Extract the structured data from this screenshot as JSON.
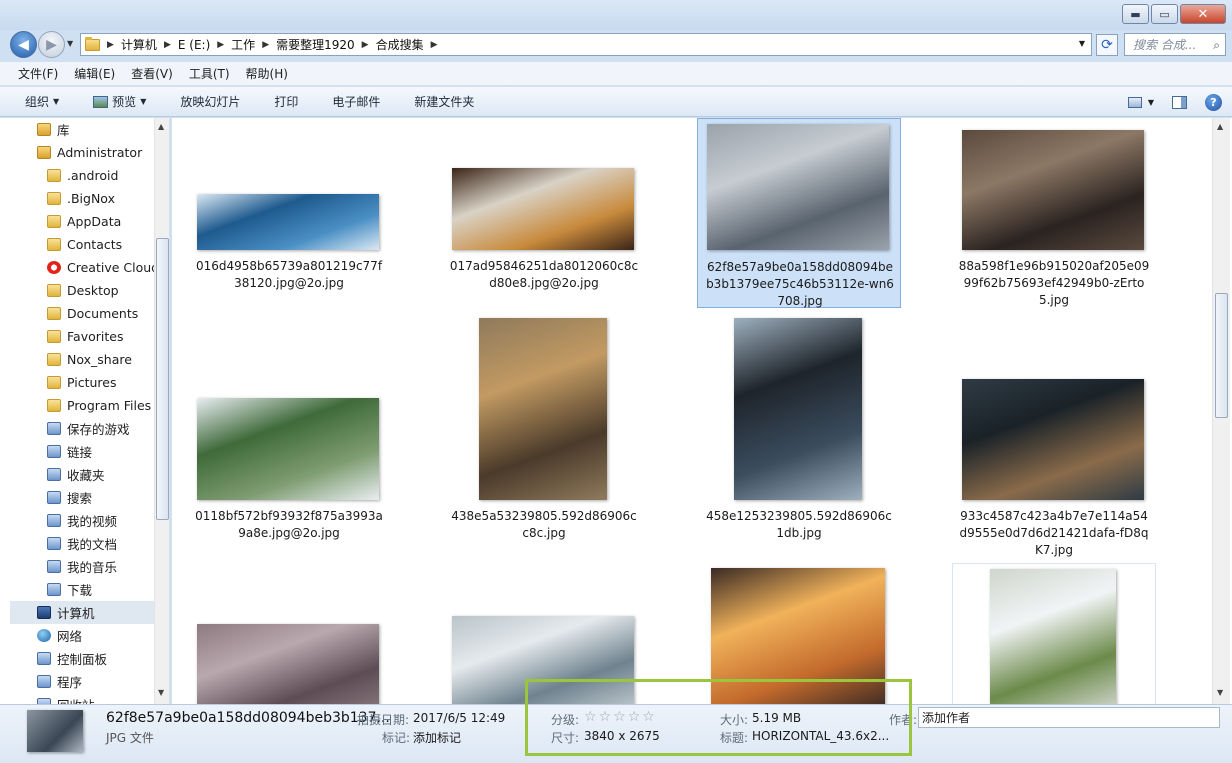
{
  "window": {
    "buttons": {
      "minimize": "▬",
      "maximize": "▭",
      "close": "✕"
    }
  },
  "address": {
    "crumbs": [
      "计算机",
      "E (E:)",
      "工作",
      "需要整理1920",
      "合成搜集"
    ],
    "search_placeholder": "搜索 合成..."
  },
  "menu": [
    "文件(F)",
    "编辑(E)",
    "查看(V)",
    "工具(T)",
    "帮助(H)"
  ],
  "toolbar": {
    "organize": "组织",
    "preview": "预览",
    "slideshow": "放映幻灯片",
    "print": "打印",
    "email": "电子邮件",
    "new_folder": "新建文件夹",
    "help": "?"
  },
  "nav": [
    {
      "label": "库",
      "icon": "library-icon",
      "indent": 1
    },
    {
      "label": "Administrator",
      "icon": "user-folder-icon",
      "indent": 1
    },
    {
      "label": ".android",
      "icon": "folder-icon",
      "indent": 2
    },
    {
      "label": ".BigNox",
      "icon": "folder-icon",
      "indent": 2
    },
    {
      "label": "AppData",
      "icon": "folder-icon",
      "indent": 2
    },
    {
      "label": "Contacts",
      "icon": "folder-icon",
      "indent": 2
    },
    {
      "label": "Creative Cloud",
      "icon": "creative-cloud-icon",
      "indent": 2
    },
    {
      "label": "Desktop",
      "icon": "folder-icon",
      "indent": 2
    },
    {
      "label": "Documents",
      "icon": "folder-icon",
      "indent": 2
    },
    {
      "label": "Favorites",
      "icon": "folder-icon",
      "indent": 2
    },
    {
      "label": "Nox_share",
      "icon": "folder-icon",
      "indent": 2
    },
    {
      "label": "Pictures",
      "icon": "folder-icon",
      "indent": 2
    },
    {
      "label": "Program Files",
      "icon": "folder-icon",
      "indent": 2
    },
    {
      "label": "保存的游戏",
      "icon": "saved-games-icon",
      "indent": 2
    },
    {
      "label": "链接",
      "icon": "links-icon",
      "indent": 2
    },
    {
      "label": "收藏夹",
      "icon": "favorites-icon",
      "indent": 2
    },
    {
      "label": "搜索",
      "icon": "searches-icon",
      "indent": 2
    },
    {
      "label": "我的视频",
      "icon": "videos-icon",
      "indent": 2
    },
    {
      "label": "我的文档",
      "icon": "documents-icon",
      "indent": 2
    },
    {
      "label": "我的音乐",
      "icon": "music-icon",
      "indent": 2
    },
    {
      "label": "下载",
      "icon": "downloads-icon",
      "indent": 2
    },
    {
      "label": "计算机",
      "icon": "computer-icon",
      "indent": 1,
      "selected": true
    },
    {
      "label": "网络",
      "icon": "network-icon",
      "indent": 1
    },
    {
      "label": "控制面板",
      "icon": "control-panel-icon",
      "indent": 1
    },
    {
      "label": "程序",
      "icon": "programs-icon",
      "indent": 1
    },
    {
      "label": "回收站",
      "icon": "recycle-bin-icon",
      "indent": 1
    }
  ],
  "files": [
    {
      "name": "016d4958b65739a801219c77f38120.jpg@2o.jpg",
      "colors": [
        "#dbe9f4",
        "#4a8fc4",
        "#1e5a8e"
      ]
    },
    {
      "name": "017ad95846251da8012060c8cd80e8.jpg@2o.jpg",
      "colors": [
        "#3b2418",
        "#c88a3c",
        "#d9d2c6"
      ]
    },
    {
      "name": "62f8e57a9be0a158dd08094beb3b1379ee75c46b53112e-wn6708.jpg",
      "colors": [
        "#9aa2ab",
        "#59636e",
        "#c6ccd2"
      ]
    },
    {
      "name": "88a598f1e96b915020af205e0999f62b75693ef42949b0-zErto5.jpg",
      "colors": [
        "#5a4a3e",
        "#2b2320",
        "#8c7865"
      ]
    },
    {
      "name": "0118bf572bf93932f875a3993a9a8e.jpg@2o.jpg",
      "colors": [
        "#e9eef2",
        "#7f9d72",
        "#3f6a3a"
      ]
    },
    {
      "name": "438e5a53239805.592d86906cc8c.jpg",
      "colors": [
        "#8f7a5c",
        "#4a3a2a",
        "#c29a62"
      ]
    },
    {
      "name": "458e1253239805.592d86906c1db.jpg",
      "colors": [
        "#9eb0be",
        "#3b4d5e",
        "#1e242b"
      ]
    },
    {
      "name": "933c4587c423a4b7e7e114a54d9555e0d7d6d21421dafa-fD8qK7.jpg",
      "colors": [
        "#2f3b44",
        "#8a6b4a",
        "#1a2228"
      ]
    },
    {
      "name": "",
      "colors": [
        "#8c7a80",
        "#5e4c55",
        "#b9a8ae"
      ]
    },
    {
      "name": "",
      "colors": [
        "#b9c4ca",
        "#6f828e",
        "#e5eaed"
      ]
    },
    {
      "name": "",
      "colors": [
        "#3a2a24",
        "#c36a2c",
        "#f1b25a"
      ]
    },
    {
      "name": "",
      "colors": [
        "#cfd6cc",
        "#6c8a4a",
        "#f1f4f6"
      ]
    }
  ],
  "details": {
    "name": "62f8e57a9be0a158dd08094beb3b137...",
    "type": "JPG 文件",
    "date_label": "拍摄日期:",
    "date_value": "2017/6/5 12:49",
    "tags_label": "标记:",
    "tags_value": "添加标记",
    "rating_label": "分级:",
    "rating_value": 0,
    "dimensions_label": "尺寸:",
    "dimensions_value": "3840 x 2675",
    "size_label": "大小:",
    "size_value": "5.19 MB",
    "title_label": "标题:",
    "title_value": "HORIZONTAL_43.6x2...",
    "author_label": "作者:",
    "author_value": "添加作者"
  },
  "colors": {
    "highlight": "#9bc53d",
    "selection": "#cce0f7"
  }
}
